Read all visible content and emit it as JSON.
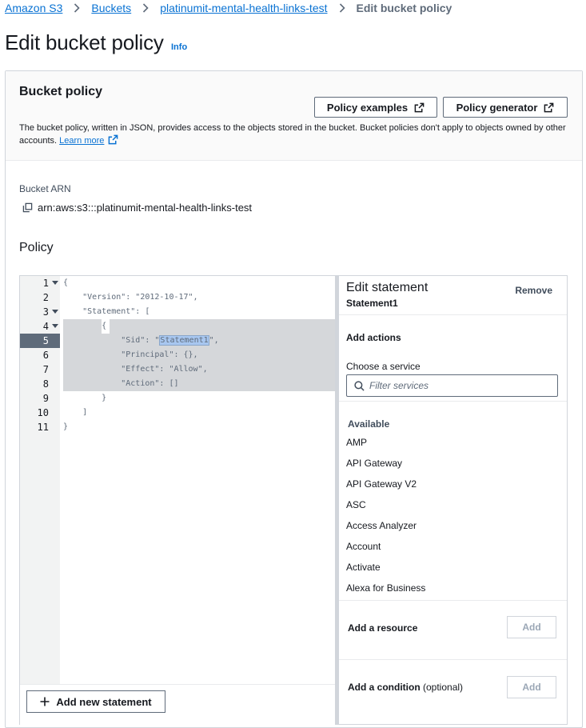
{
  "breadcrumbs": {
    "items": [
      "Amazon S3",
      "Buckets",
      "platinumit-mental-health-links-test"
    ],
    "current": "Edit bucket policy"
  },
  "page": {
    "title": "Edit bucket policy",
    "info": "Info"
  },
  "bucket_policy": {
    "title": "Bucket policy",
    "policy_examples_label": "Policy examples",
    "policy_generator_label": "Policy generator",
    "description": "The bucket policy, written in JSON, provides access to the objects stored in the bucket. Bucket policies don't apply to objects owned by other accounts.",
    "learn_more": "Learn more"
  },
  "bucket_arn": {
    "label": "Bucket ARN",
    "value": "arn:aws:s3:::platinumit-mental-health-links-test"
  },
  "policy": {
    "label": "Policy",
    "active_line": 5,
    "selected_word": "Statement1",
    "lines": [
      "{",
      "    \"Version\": \"2012-10-17\",",
      "    \"Statement\": [",
      "        {",
      "            \"Sid\": \"Statement1\",",
      "            \"Principal\": {},",
      "            \"Effect\": \"Allow\",",
      "            \"Action\": []",
      "        }",
      "    ]",
      "}"
    ],
    "line_numbers": [
      "1",
      "2",
      "3",
      "4",
      "5",
      "6",
      "7",
      "8",
      "9",
      "10",
      "11"
    ],
    "add_new_statement_label": "Add new statement"
  },
  "edit_statement": {
    "title": "Edit statement",
    "statement_name": "Statement1",
    "remove_label": "Remove",
    "add_actions_label": "Add actions",
    "choose_service_label": "Choose a service",
    "filter_placeholder": "Filter services",
    "available_label": "Available",
    "services": [
      "AMP",
      "API Gateway",
      "API Gateway V2",
      "ASC",
      "Access Analyzer",
      "Account",
      "Activate",
      "Alexa for Business"
    ],
    "add_resource_label": "Add a resource",
    "add_condition_label": "Add a condition",
    "optional_label": "(optional)",
    "add_button_label": "Add"
  },
  "icons": {
    "breadcrumb_separator": "chevron-right-icon",
    "external": "external-link-icon",
    "copy": "copy-icon",
    "search": "search-icon",
    "fold": "fold-arrow-icon",
    "plus": "plus-icon"
  },
  "colors": {
    "link": "#0972d3",
    "text": "#16191f",
    "muted": "#5f6b7a",
    "header_bg": "#fafafa",
    "gutter_bg": "#f2f3f3",
    "selection_bg": "#d5d7da",
    "word_highlight": "#a8c7f0"
  }
}
